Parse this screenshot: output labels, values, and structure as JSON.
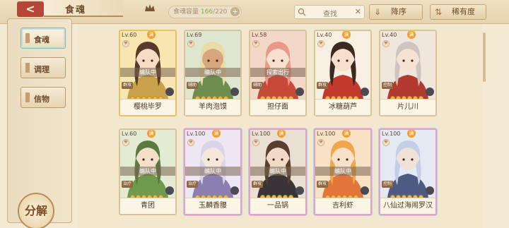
{
  "header": {
    "title": "食魂",
    "back_label": "<",
    "capacity_label": "食魂容量",
    "capacity_current": "166",
    "capacity_total": "/220",
    "capacity_plus": "+",
    "search_placeholder": "查找",
    "clear_label": "✕",
    "sort_order_label": "降序",
    "sort_rarity_label": "稀有度"
  },
  "sidebar": {
    "items": [
      {
        "label": "食魂",
        "active": true
      },
      {
        "label": "调理",
        "active": false
      },
      {
        "label": "信物",
        "active": false
      }
    ],
    "decompose_label": "分解"
  },
  "cards": [
    {
      "level": "Lv.60",
      "status": "编队中",
      "name": "樱桃毕罗",
      "type": "群攻",
      "man": true,
      "rarity": "gold",
      "colors": {
        "bg": "#f7e6b0",
        "hair": "#5a3a2a",
        "cloth": "#c9a14a",
        "skin": "#f6dcc5"
      }
    },
    {
      "level": "Lv.69",
      "status": "编队中",
      "name": "羊肉泡馍",
      "type": "辅助",
      "man": false,
      "rarity": "normal",
      "colors": {
        "bg": "#dfe6cf",
        "hair": "#e8dca8",
        "cloth": "#6d8e4c",
        "skin": "#d8a67e"
      }
    },
    {
      "level": "Lv.58",
      "status": "探索出行",
      "name": "担仔面",
      "type": "辅助",
      "man": false,
      "rarity": "normal",
      "colors": {
        "bg": "#f3d8c8",
        "hair": "#e89a8a",
        "cloth": "#c8483a",
        "skin": "#f8e0cf"
      }
    },
    {
      "level": "Lv.40",
      "status": "",
      "name": "冰糖葫芦",
      "type": "群攻",
      "man": true,
      "rarity": "normal",
      "colors": {
        "bg": "#f7efe2",
        "hair": "#3a2a22",
        "cloth": "#c4392e",
        "skin": "#f7dfcb"
      }
    },
    {
      "level": "Lv.40",
      "status": "",
      "name": "片儿川",
      "type": "控制",
      "man": true,
      "rarity": "normal",
      "colors": {
        "bg": "#f0e6dc",
        "hair": "#cfc5c0",
        "cloth": "#b33a2e",
        "skin": "#f5e2d4"
      }
    },
    {
      "level": "Lv.60",
      "status": "编队中",
      "name": "青团",
      "type": "治疗",
      "man": true,
      "rarity": "normal",
      "colors": {
        "bg": "#e3ecd2",
        "hair": "#5c7a3e",
        "cloth": "#6f9a4b",
        "skin": "#f4dfc8"
      }
    },
    {
      "level": "Lv.100",
      "status": "编队中",
      "name": "玉麟香腰",
      "type": "治疗",
      "man": true,
      "rarity": "rainbow",
      "colors": {
        "bg": "#eee6f2",
        "hair": "#d9d4ea",
        "cloth": "#8a7fb0",
        "skin": "#f6e6dc"
      }
    },
    {
      "level": "Lv.100",
      "status": "编队中",
      "name": "一品锅",
      "type": "群攻",
      "man": true,
      "rarity": "rainbow",
      "colors": {
        "bg": "#e9dfd3",
        "hair": "#5b3f2e",
        "cloth": "#3a3438",
        "skin": "#f3dac6"
      }
    },
    {
      "level": "Lv.100",
      "status": "编队中",
      "name": "吉利虾",
      "type": "群攻",
      "man": true,
      "rarity": "rainbow",
      "colors": {
        "bg": "#f8e2c6",
        "hair": "#f0a74b",
        "cloth": "#e2753a",
        "skin": "#f8e0cb"
      }
    },
    {
      "level": "Lv.100",
      "status": "",
      "name": "八仙过海闹罗汉",
      "type": "控制",
      "man": true,
      "rarity": "rainbow",
      "colors": {
        "bg": "#e4eaf3",
        "hair": "#c6cde6",
        "cloth": "#4d5a82",
        "skin": "#f1e2d8"
      }
    }
  ]
}
